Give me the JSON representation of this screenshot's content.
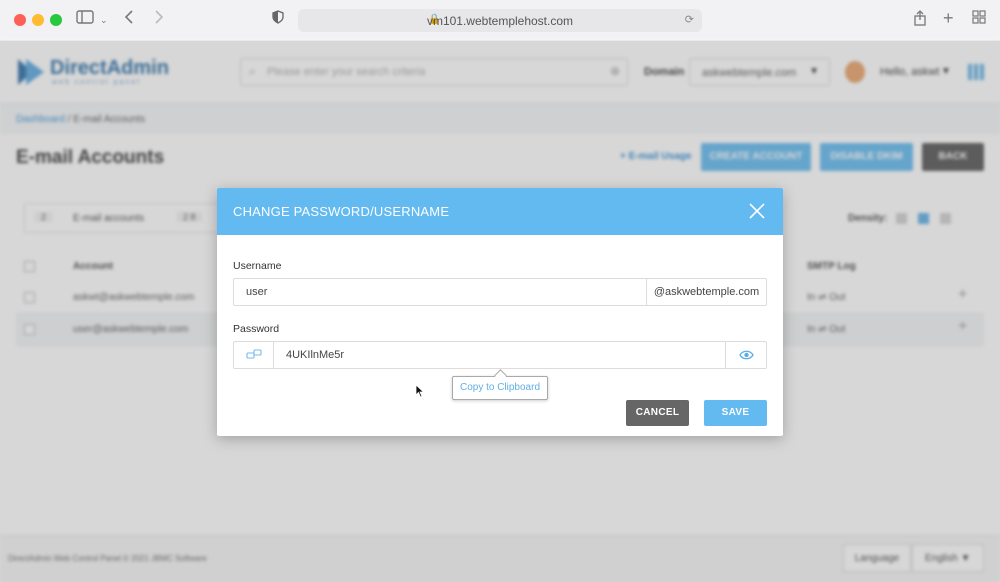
{
  "browser": {
    "url": "vm101.webtemplehost.com",
    "tab_icons": [
      "sidebar-icon",
      "back-icon",
      "forward-icon",
      "shield-icon",
      "share-icon",
      "new-tab-icon",
      "tabs-overview-icon"
    ]
  },
  "header": {
    "logo_text": "DirectAdmin",
    "logo_sub": "web control panel",
    "search_placeholder": "Please enter your search criteria",
    "domain_label": "Domain",
    "domain_value": "askwebtemple.com",
    "greeting": "Hello, askwt"
  },
  "breadcrumb": {
    "root": "Dashboard",
    "separator": " / ",
    "current": "E-mail Accounts"
  },
  "page": {
    "title": "E-mail Accounts",
    "usage_link": "+ E-mail Usage",
    "buttons": {
      "create": "CREATE ACCOUNT",
      "disable": "DISABLE DKIM",
      "back": "BACK"
    },
    "stats": {
      "accounts_count": "2",
      "accounts_label": "E-mail accounts",
      "other_count": "2 8"
    },
    "density_label": "Density:",
    "table": {
      "headers": {
        "account": "Account",
        "smtp": "SMTP Log"
      },
      "rows": [
        {
          "account": "askwt@askwebtemple.com",
          "smtp": "In ⇌ Out"
        },
        {
          "account": "user@askwebtemple.com",
          "smtp": "In ⇌ Out"
        }
      ]
    }
  },
  "footer": {
    "copyright": "DirectAdmin Web Control Panel © 2021 JBMC Software",
    "language_button": "Language",
    "language_value": "English"
  },
  "modal": {
    "title": "CHANGE PASSWORD/USERNAME",
    "username_label": "Username",
    "username_value": "user",
    "domain_suffix": "@askwebtemple.com",
    "password_label": "Password",
    "password_value": "4UKIlnMe5r",
    "tooltip": "Copy to Clipboard",
    "cancel_label": "CANCEL",
    "save_label": "SAVE"
  },
  "colors": {
    "accent": "#62baf0",
    "cancel": "#666666",
    "back": "#555555"
  }
}
